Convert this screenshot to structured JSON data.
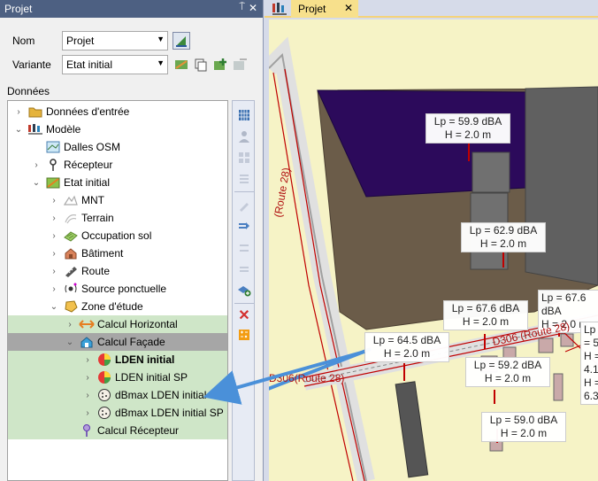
{
  "left_panel": {
    "title": "Projet",
    "pin_glyph": "⍑",
    "close_glyph": "✕",
    "nom_label": "Nom",
    "nom_value": "Projet",
    "variante_label": "Variante",
    "variante_value": "Etat initial",
    "donnees_label": "Données",
    "tree": [
      {
        "label": "Données d'entrée",
        "icon": "folder-icon"
      },
      {
        "label": "Modèle",
        "icon": "model-icon"
      },
      {
        "label": "Dalles OSM",
        "icon": "map-icon"
      },
      {
        "label": "Récepteur",
        "icon": "receiver-icon"
      },
      {
        "label": "Etat initial",
        "icon": "state-icon"
      },
      {
        "label": "MNT",
        "icon": "mnt-icon"
      },
      {
        "label": "Terrain",
        "icon": "terrain-icon"
      },
      {
        "label": "Occupation sol",
        "icon": "land-use-icon"
      },
      {
        "label": "Bâtiment",
        "icon": "building-icon"
      },
      {
        "label": "Route",
        "icon": "road-icon"
      },
      {
        "label": "Source ponctuelle",
        "icon": "point-source-icon"
      },
      {
        "label": "Zone d'étude",
        "icon": "zone-icon"
      },
      {
        "label": "Calcul Horizontal",
        "icon": "horizontal-calc-icon"
      },
      {
        "label": "Calcul Façade",
        "icon": "facade-calc-icon"
      },
      {
        "label": "LDEN initial",
        "icon": "result-map-icon"
      },
      {
        "label": "LDEN initial SP",
        "icon": "result-map-icon"
      },
      {
        "label": "dBmax LDEN initial",
        "icon": "dbmax-icon"
      },
      {
        "label": "dBmax LDEN initial SP",
        "icon": "dbmax-icon"
      },
      {
        "label": "Calcul Récepteur",
        "icon": "receiver-calc-icon"
      }
    ]
  },
  "right_panel": {
    "tab_label": "Projet",
    "tab_close": "✕",
    "map_labels": [
      {
        "lp": "Lp = 59.9 dBA",
        "h": "H = 2.0 m"
      },
      {
        "lp": "Lp = 62.9 dBA",
        "h": "H = 2.0 m"
      },
      {
        "lp": "Lp = 67.6 dBA",
        "h": "H = 2.0 m"
      },
      {
        "lp": "Lp = 67.6 dBA",
        "h": "H = 2.0 m"
      },
      {
        "lp": "Lp = 64.5 dBA",
        "h": "H = 2.0 m"
      },
      {
        "lp": "Lp = 59.2 dBA",
        "h": "H = 2.0 m"
      },
      {
        "lp": "Lp = 59.0 dBA",
        "h": "H = 2.0 m"
      },
      {
        "lp": "Lp = 5",
        "h": "H = 4.1"
      }
    ],
    "partial_label_third_line": "H = 6.3",
    "road_labels": [
      "D306(Route 28)",
      "(Route 28)",
      "D306 (Route 28)"
    ]
  },
  "colors": {
    "panel_header": "#4d6082",
    "highlight_green": "#cfe6c8",
    "selected_gray": "#a6a6a6",
    "map_background": "#f6f3c6",
    "zone_purple": "#2c0a5b",
    "zone_brown": "#6b5c49",
    "road_red": "#c00000",
    "arrow_blue": "#4a90d9",
    "tab_yellow": "#f7e08c"
  }
}
